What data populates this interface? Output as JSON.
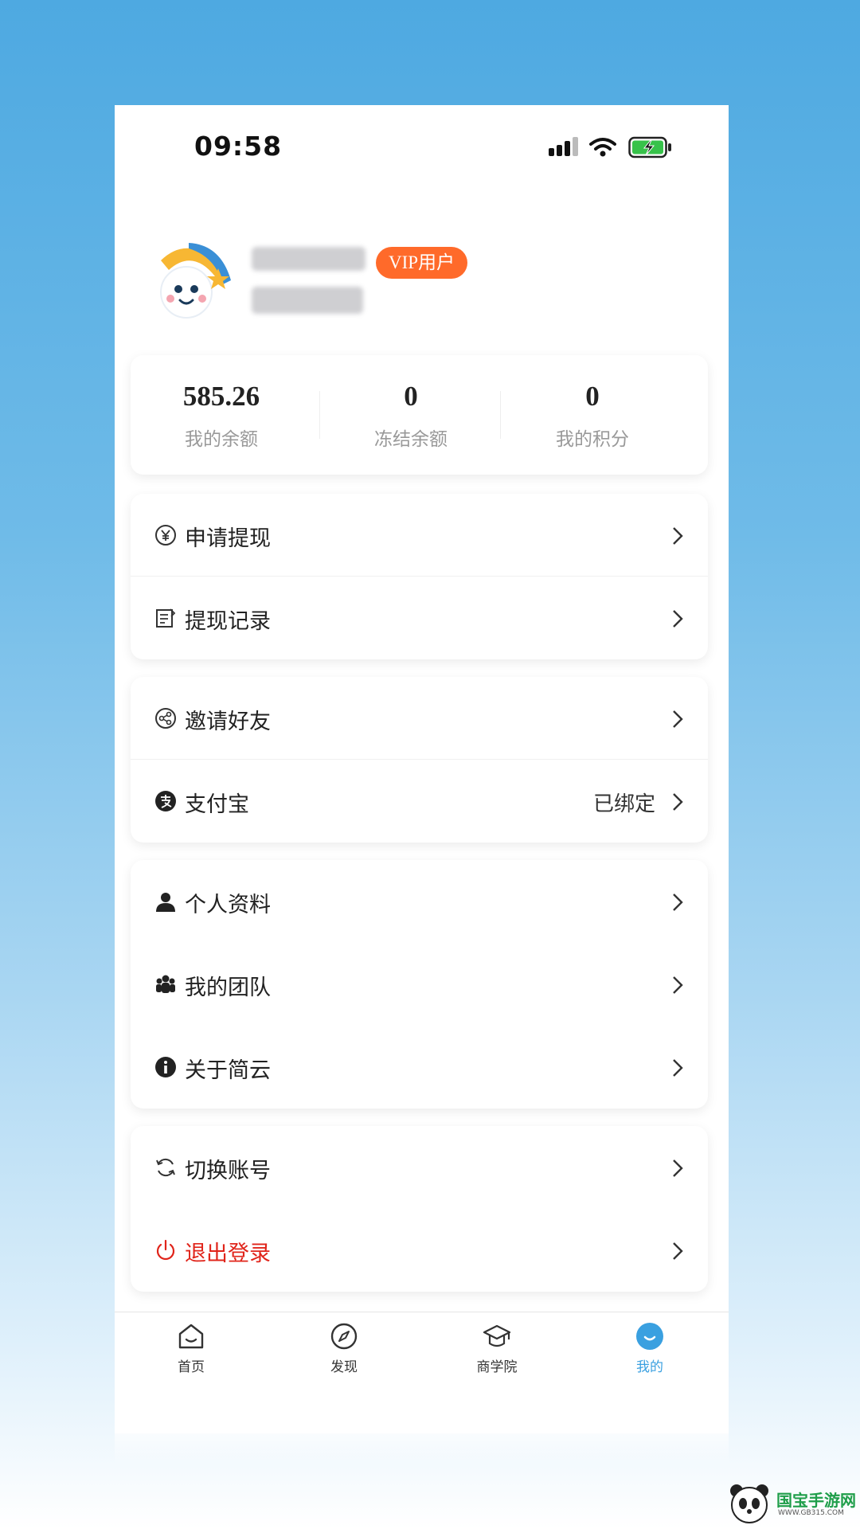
{
  "status_bar": {
    "time": "09:58"
  },
  "profile": {
    "vip_label": "VIP用户"
  },
  "stats": [
    {
      "value": "585.26",
      "label": "我的余额"
    },
    {
      "value": "0",
      "label": "冻结余额"
    },
    {
      "value": "0",
      "label": "我的积分"
    }
  ],
  "menu": {
    "withdraw_apply": "申请提现",
    "withdraw_records": "提现记录",
    "invite_friends": "邀请好友",
    "alipay": "支付宝",
    "alipay_status": "已绑定",
    "personal_info": "个人资料",
    "my_team": "我的团队",
    "about": "关于简云",
    "switch_account": "切换账号",
    "logout": "退出登录"
  },
  "tabs": [
    {
      "label": "首页"
    },
    {
      "label": "发现"
    },
    {
      "label": "商学院"
    },
    {
      "label": "我的"
    }
  ],
  "watermark": {
    "name": "国宝手游网",
    "url": "WWW.GB315.COM"
  },
  "colors": {
    "accent": "#3aa0e0",
    "vip": "#ff6a2a",
    "logout": "#e0241a"
  }
}
